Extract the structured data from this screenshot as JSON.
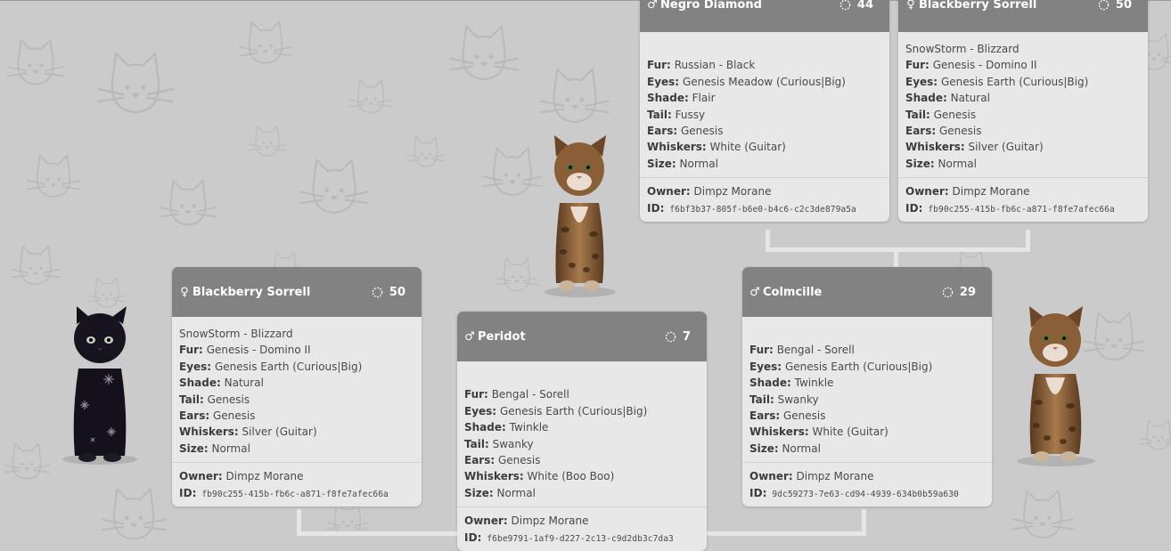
{
  "labels": {
    "fur": "Fur:",
    "eyes": "Eyes:",
    "shade": "Shade:",
    "tail": "Tail:",
    "ears": "Ears:",
    "whiskers": "Whiskers:",
    "size": "Size:",
    "owner": "Owner:",
    "id": "ID:"
  },
  "symbols": {
    "male": "♂",
    "female": "♀"
  },
  "colors": {
    "page_bg": "#cbcbcb",
    "header_bg": "#828282",
    "card_bg": "#e8e8e8",
    "connector": "#e6e6e6"
  },
  "icons": [
    "male-icon",
    "female-icon",
    "level-icon",
    "cat-pattern-icon"
  ],
  "cards": {
    "negro_diamond": {
      "sex": "male",
      "name": "Negro Diamond",
      "level": "44",
      "breed": "",
      "fur": "Russian - Black",
      "eyes": "Genesis Meadow (Curious|Big)",
      "shade": "Flair",
      "tail": "Fussy",
      "ears": "Genesis",
      "whiskers": "White (Guitar)",
      "size": "Normal",
      "owner": "Dimpz Morane",
      "id": "f6bf3b37-805f-b6e0-b4c6-c2c3de879a5a"
    },
    "blackberry_top": {
      "sex": "female",
      "name": "Blackberry Sorrell",
      "level": "50",
      "breed": "SnowStorm - Blizzard",
      "fur": "Genesis - Domino II",
      "eyes": "Genesis Earth (Curious|Big)",
      "shade": "Natural",
      "tail": "Genesis",
      "ears": "Genesis",
      "whiskers": "Silver (Guitar)",
      "size": "Normal",
      "owner": "Dimpz Morane",
      "id": "fb90c255-415b-fb6c-a871-f8fe7afec66a"
    },
    "blackberry_left": {
      "sex": "female",
      "name": "Blackberry Sorrell",
      "level": "50",
      "breed": "SnowStorm - Blizzard",
      "fur": "Genesis - Domino II",
      "eyes": "Genesis Earth (Curious|Big)",
      "shade": "Natural",
      "tail": "Genesis",
      "ears": "Genesis",
      "whiskers": "Silver (Guitar)",
      "size": "Normal",
      "owner": "Dimpz Morane",
      "id": "fb90c255-415b-fb6c-a871-f8fe7afec66a"
    },
    "peridot": {
      "sex": "male",
      "name": "Peridot",
      "level": "7",
      "breed": "",
      "fur": "Bengal - Sorell",
      "eyes": "Genesis Earth (Curious|Big)",
      "shade": "Twinkle",
      "tail": "Swanky",
      "ears": "Genesis",
      "whiskers": "White (Boo Boo)",
      "size": "Normal",
      "owner": "Dimpz Morane",
      "id": "f6be9791-1af9-d227-2c13-c9d2db3c7da3"
    },
    "colmcille": {
      "sex": "male",
      "name": "Colmcille",
      "level": "29",
      "breed": "",
      "fur": "Bengal - Sorell",
      "eyes": "Genesis Earth (Curious|Big)",
      "shade": "Twinkle",
      "tail": "Swanky",
      "ears": "Genesis",
      "whiskers": "White (Guitar)",
      "size": "Normal",
      "owner": "Dimpz Morane",
      "id": "9dc59273-7e63-cd94-4939-634b0b59a630"
    }
  }
}
